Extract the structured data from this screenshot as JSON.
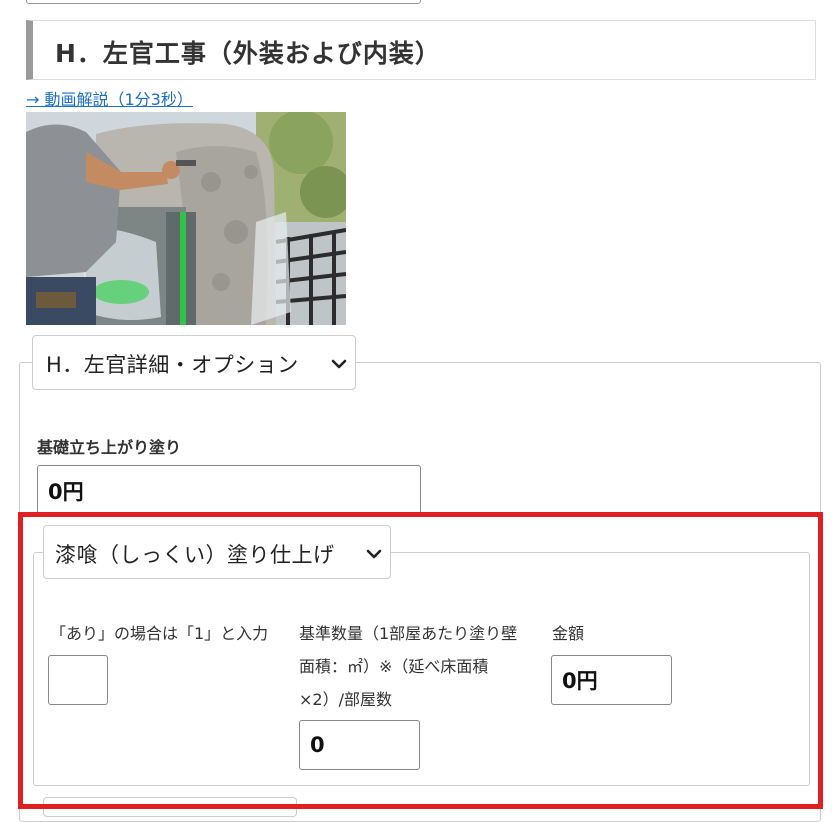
{
  "section": {
    "heading": "H．左官工事（外装および内装）",
    "video_link": "→ 動画解説（1分3秒）"
  },
  "options": {
    "summary_label": "H．左官詳細・オプション",
    "foundation": {
      "label": "基礎立ち上がり塗り",
      "value": "0円"
    }
  },
  "shikkui": {
    "summary_label": "漆喰（しっくい）塗り仕上げ",
    "presence": {
      "label": "「あり」の場合は「1」と入力",
      "value": ""
    },
    "quantity": {
      "label_line1": "基準数量（1部屋あたり塗り壁",
      "label_line2": "面積：㎡）※（延べ床面積",
      "label_line3": "×2）/部屋数",
      "value": "0"
    },
    "amount": {
      "label": "金額",
      "value": "0円"
    }
  },
  "colors": {
    "highlight": "#e02020",
    "link": "#1a6fc4",
    "heading_bar": "#999999"
  }
}
